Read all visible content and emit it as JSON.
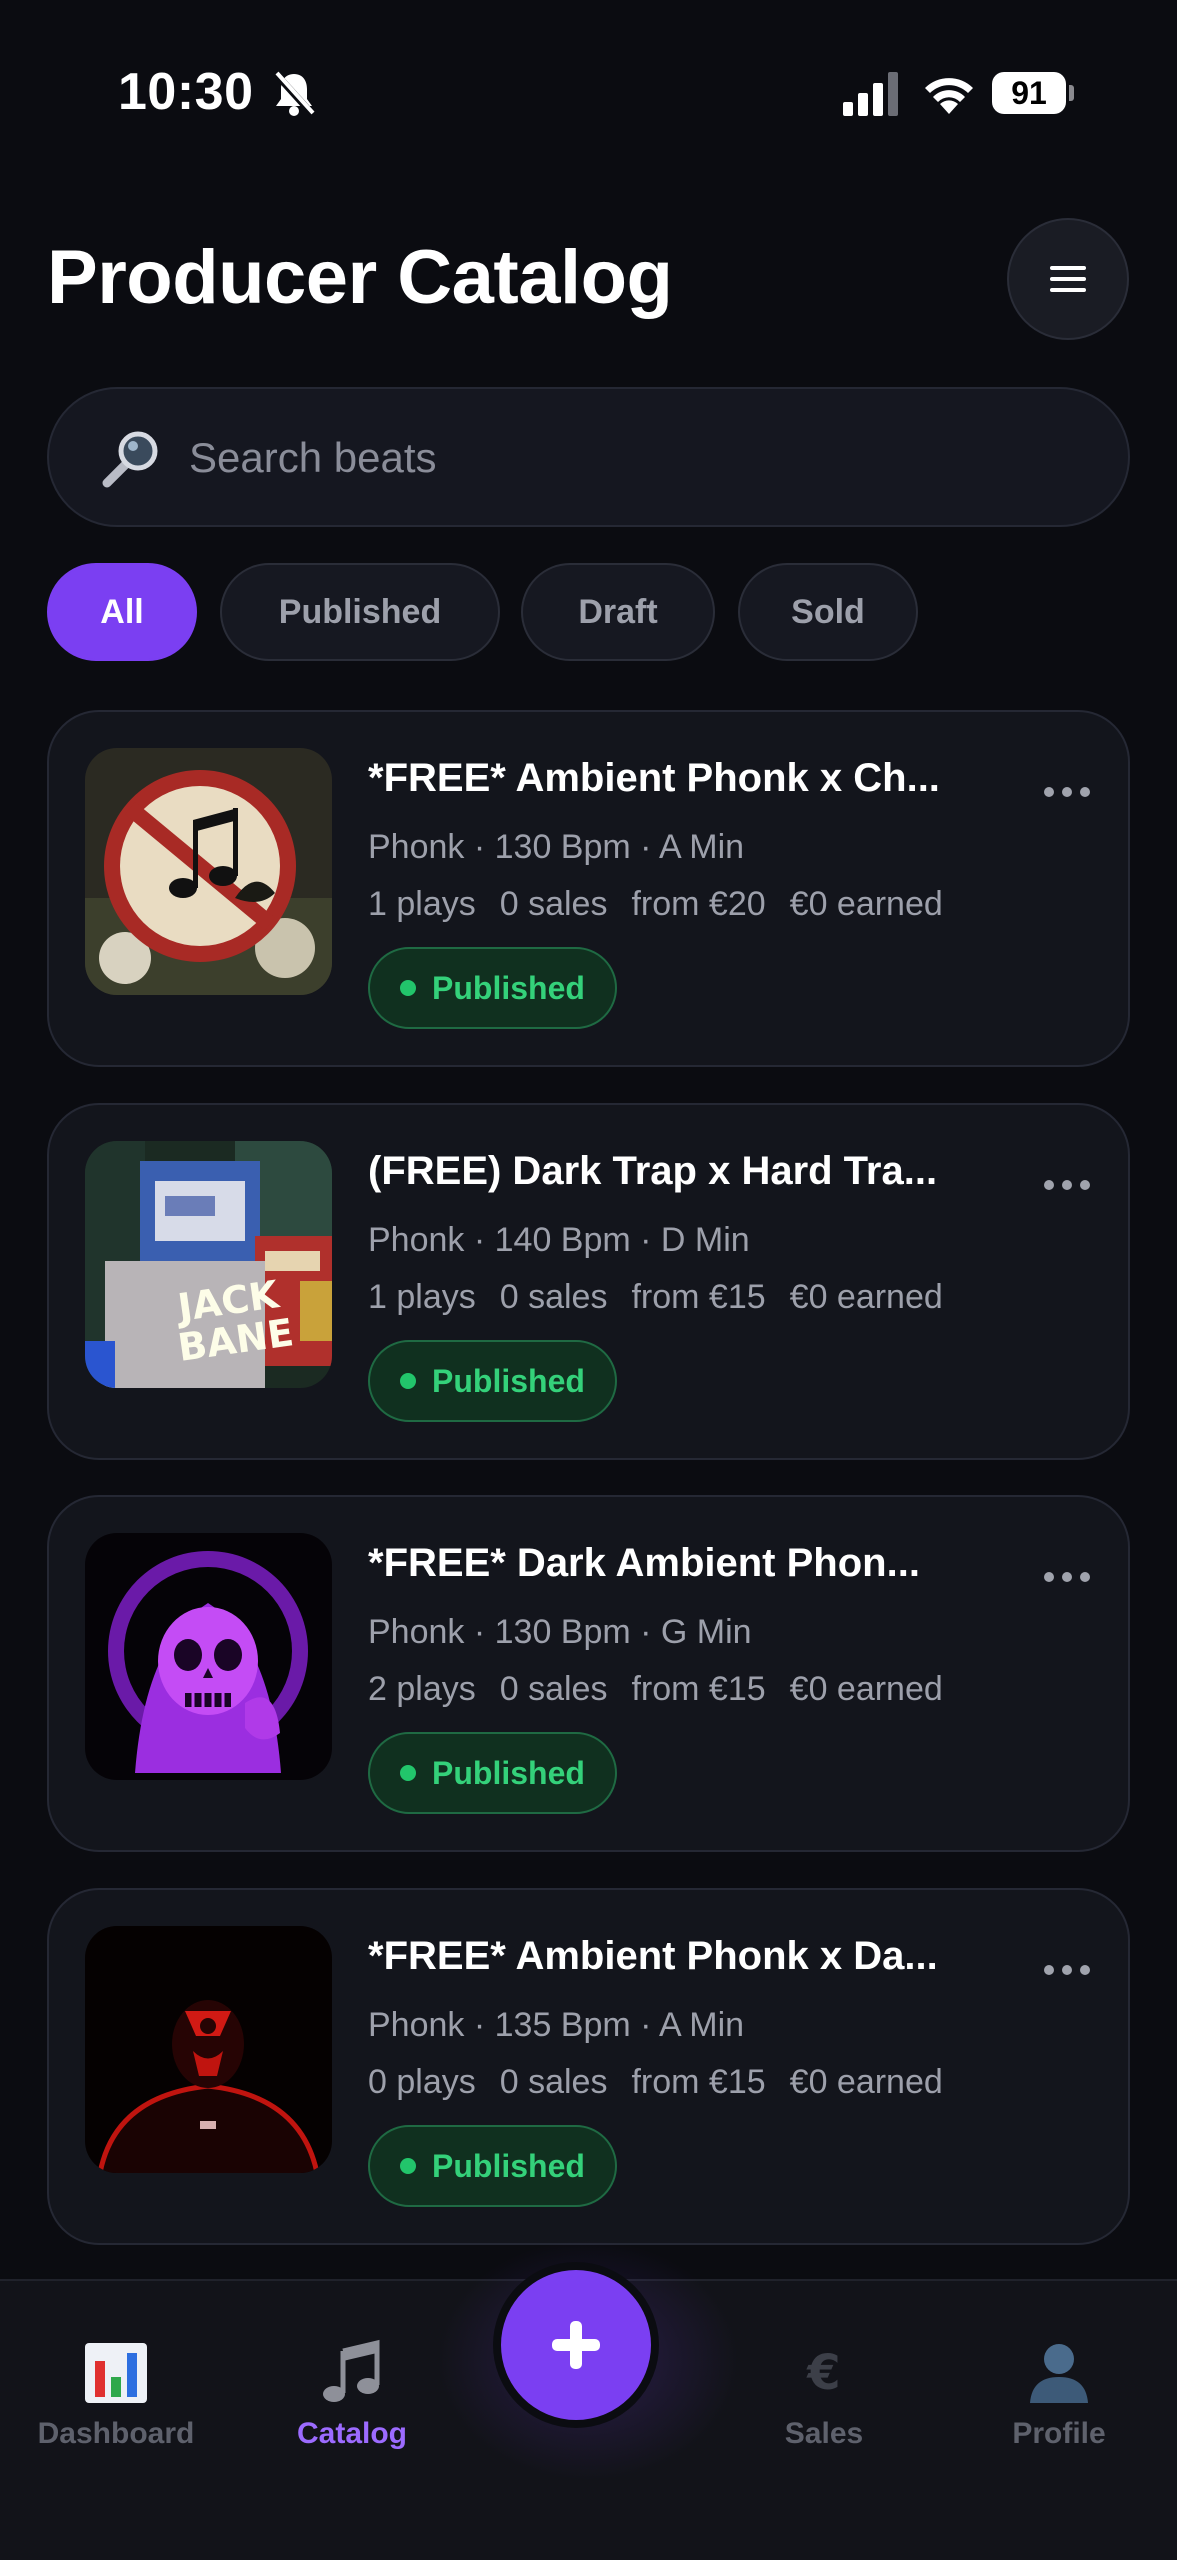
{
  "status_bar": {
    "time": "10:30",
    "battery": "91",
    "icons": [
      "bell-off-icon",
      "signal-icon",
      "wifi-icon",
      "battery-icon"
    ]
  },
  "header": {
    "title": "Producer Catalog",
    "menu_icon": "hamburger-icon"
  },
  "search": {
    "placeholder": "Search beats",
    "icon": "magnifier-icon"
  },
  "filters": [
    {
      "label": "All",
      "active": true
    },
    {
      "label": "Published",
      "active": false
    },
    {
      "label": "Draft",
      "active": false
    },
    {
      "label": "Sold",
      "active": false
    }
  ],
  "beats": [
    {
      "title": "*FREE* Ambient Phonk x Ch...",
      "meta": "Phonk · 130 Bpm · A Min",
      "plays": "1 plays",
      "sales": "0 sales",
      "price": "from €20",
      "earned": "€0 earned",
      "status": "Published",
      "cover": "music-sign-cover"
    },
    {
      "title": "(FREE) Dark Trap x Hard Tra...",
      "meta": "Phonk · 140 Bpm · D Min",
      "plays": "1 plays",
      "sales": "0 sales",
      "price": "from €15",
      "earned": "€0 earned",
      "status": "Published",
      "cover": "billboard-cover"
    },
    {
      "title": "*FREE* Dark Ambient Phon...",
      "meta": "Phonk · 130 Bpm · G Min",
      "plays": "2 plays",
      "sales": "0 sales",
      "price": "from €15",
      "earned": "€0 earned",
      "status": "Published",
      "cover": "purple-skull-cover"
    },
    {
      "title": "*FREE* Ambient Phonk x Da...",
      "meta": "Phonk · 135 Bpm · A Min",
      "plays": "0 plays",
      "sales": "0 sales",
      "price": "from €15",
      "earned": "€0 earned",
      "status": "Published",
      "cover": "red-mask-cover"
    }
  ],
  "bottom_nav": {
    "items": [
      {
        "label": "Dashboard",
        "icon": "bar-chart-icon",
        "active": false
      },
      {
        "label": "Catalog",
        "icon": "music-note-icon",
        "active": true
      },
      {
        "label": "Sales",
        "icon": "euro-icon",
        "active": false
      },
      {
        "label": "Profile",
        "icon": "user-icon",
        "active": false
      }
    ],
    "fab_icon": "plus-icon"
  },
  "colors": {
    "background": "#0b0c11",
    "card": "#13151c",
    "accent": "#7b3ff2",
    "published_text": "#34d17a",
    "published_bg": "#10301f",
    "muted_text": "#9da0ab"
  }
}
